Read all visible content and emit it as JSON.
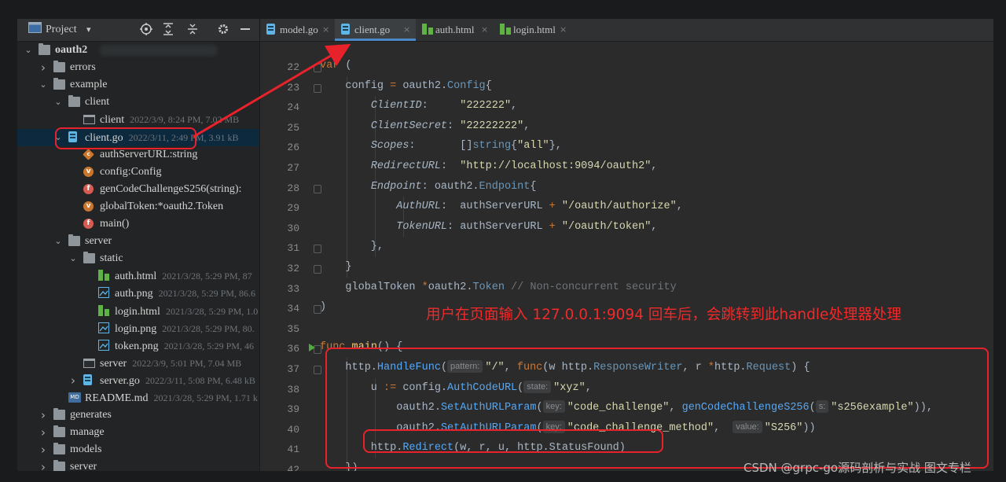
{
  "panel": {
    "title": "Project",
    "title_dropdown": "▾",
    "toolbar_icons": [
      "target-icon",
      "expand-all-icon",
      "collapse-all-icon",
      "gear-icon",
      "minimize-icon"
    ]
  },
  "tree": [
    {
      "label": "oauth2",
      "type": "folder",
      "arrow": "expanded",
      "bold": true,
      "blurred_path": true
    },
    {
      "label": "errors",
      "type": "folder",
      "arrow": "collapsed"
    },
    {
      "label": "example",
      "type": "folder",
      "arrow": "expanded"
    },
    {
      "label": "client",
      "type": "folder",
      "arrow": "expanded"
    },
    {
      "label": "client",
      "type": "binary",
      "meta": "2022/3/9, 8:24 PM, 7.02 MB"
    },
    {
      "label": "client.go",
      "type": "go",
      "arrow": "expanded",
      "meta": "2022/3/11, 2:49 PM, 3.91 kB",
      "selected": true
    },
    {
      "label": "authServerURL:string",
      "type": "member",
      "badge": "c"
    },
    {
      "label": "config:Config",
      "type": "member",
      "badge": "v"
    },
    {
      "label": "genCodeChallengeS256(string):",
      "type": "member",
      "badge": "f"
    },
    {
      "label": "globalToken:*oauth2.Token",
      "type": "member",
      "badge": "v"
    },
    {
      "label": "main()",
      "type": "member",
      "badge": "f"
    },
    {
      "label": "server",
      "type": "folder",
      "arrow": "expanded"
    },
    {
      "label": "static",
      "type": "folder",
      "arrow": "expanded"
    },
    {
      "label": "auth.html",
      "type": "html",
      "meta": "2021/3/28, 5:29 PM, 87"
    },
    {
      "label": "auth.png",
      "type": "png",
      "meta": "2021/3/28, 5:29 PM, 86.6"
    },
    {
      "label": "login.html",
      "type": "html",
      "meta": "2021/3/28, 5:29 PM, 1.0"
    },
    {
      "label": "login.png",
      "type": "png",
      "meta": "2021/3/28, 5:29 PM, 80."
    },
    {
      "label": "token.png",
      "type": "png",
      "meta": "2021/3/28, 5:29 PM, 46"
    },
    {
      "label": "server",
      "type": "binary",
      "meta": "2022/3/9, 5:01 PM, 7.04 MB"
    },
    {
      "label": "server.go",
      "type": "go",
      "arrow": "collapsed",
      "meta": "2022/3/11, 5:08 PM, 6.48 kB"
    },
    {
      "label": "README.md",
      "type": "md",
      "meta": "2021/3/28, 5:29 PM, 1.71 k"
    },
    {
      "label": "generates",
      "type": "folder",
      "arrow": "collapsed"
    },
    {
      "label": "manage",
      "type": "folder",
      "arrow": "collapsed"
    },
    {
      "label": "models",
      "type": "folder",
      "arrow": "collapsed"
    },
    {
      "label": "server",
      "type": "folder",
      "arrow": "collapsed"
    }
  ],
  "tabs": [
    {
      "label": "model.go",
      "type": "go",
      "active": false,
      "close": "×"
    },
    {
      "label": "client.go",
      "type": "go",
      "active": true,
      "close": "×"
    },
    {
      "label": "auth.html",
      "type": "html",
      "active": false,
      "close": "×"
    },
    {
      "label": "login.html",
      "type": "html",
      "active": false,
      "close": "×"
    }
  ],
  "code": {
    "line_numbers": [
      "22",
      "23",
      "24",
      "25",
      "26",
      "27",
      "28",
      "29",
      "30",
      "31",
      "32",
      "33",
      "34",
      "35",
      "36",
      "37",
      "38",
      "39",
      "40",
      "41",
      "42"
    ],
    "lines": [
      [
        {
          "t": "var",
          "c": "kw"
        },
        {
          "t": " (",
          "c": ""
        }
      ],
      [
        {
          "t": "    config ",
          "c": ""
        },
        {
          "t": "=",
          "c": "op"
        },
        {
          "t": " oauth2.",
          "c": ""
        },
        {
          "t": "Config",
          "c": "ty"
        },
        {
          "t": "{",
          "c": ""
        }
      ],
      [
        {
          "t": "        ",
          "c": ""
        },
        {
          "t": "ClientID",
          "c": "fld2"
        },
        {
          "t": ":     ",
          "c": ""
        },
        {
          "t": "\"222222\"",
          "c": "st2"
        },
        {
          "t": ",",
          "c": ""
        }
      ],
      [
        {
          "t": "        ",
          "c": ""
        },
        {
          "t": "ClientSecret",
          "c": "fld2"
        },
        {
          "t": ": ",
          "c": ""
        },
        {
          "t": "\"22222222\"",
          "c": "st2"
        },
        {
          "t": ",",
          "c": ""
        }
      ],
      [
        {
          "t": "        ",
          "c": ""
        },
        {
          "t": "Scopes",
          "c": "fld2"
        },
        {
          "t": ":       []",
          "c": ""
        },
        {
          "t": "string",
          "c": "ty"
        },
        {
          "t": "{",
          "c": ""
        },
        {
          "t": "\"all\"",
          "c": "st2"
        },
        {
          "t": "},",
          "c": ""
        }
      ],
      [
        {
          "t": "        ",
          "c": ""
        },
        {
          "t": "RedirectURL",
          "c": "fld2"
        },
        {
          "t": ":  ",
          "c": ""
        },
        {
          "t": "\"http://localhost:9094/oauth2\"",
          "c": "st2"
        },
        {
          "t": ",",
          "c": ""
        }
      ],
      [
        {
          "t": "        ",
          "c": ""
        },
        {
          "t": "Endpoint",
          "c": "fld2"
        },
        {
          "t": ": oauth2.",
          "c": ""
        },
        {
          "t": "Endpoint",
          "c": "ty"
        },
        {
          "t": "{",
          "c": ""
        }
      ],
      [
        {
          "t": "            ",
          "c": ""
        },
        {
          "t": "AuthURL",
          "c": "fld2"
        },
        {
          "t": ":  authServerURL ",
          "c": ""
        },
        {
          "t": "+",
          "c": "op"
        },
        {
          "t": " ",
          "c": ""
        },
        {
          "t": "\"/oauth/authorize\"",
          "c": "st2"
        },
        {
          "t": ",",
          "c": ""
        }
      ],
      [
        {
          "t": "            ",
          "c": ""
        },
        {
          "t": "TokenURL",
          "c": "fld2"
        },
        {
          "t": ": authServerURL ",
          "c": ""
        },
        {
          "t": "+",
          "c": "op"
        },
        {
          "t": " ",
          "c": ""
        },
        {
          "t": "\"/oauth/token\"",
          "c": "st2"
        },
        {
          "t": ",",
          "c": ""
        }
      ],
      [
        {
          "t": "        },",
          "c": ""
        }
      ],
      [
        {
          "t": "    }",
          "c": ""
        }
      ],
      [
        {
          "t": "    globalToken ",
          "c": ""
        },
        {
          "t": "*",
          "c": "op"
        },
        {
          "t": "oauth2.",
          "c": ""
        },
        {
          "t": "Token",
          "c": "ty"
        },
        {
          "t": " ",
          "c": ""
        },
        {
          "t": "// Non-concurrent security",
          "c": "cm"
        }
      ],
      [
        {
          "t": ")",
          "c": ""
        }
      ],
      [
        {
          "t": "",
          "c": ""
        }
      ],
      [
        {
          "t": "func",
          "c": "kw"
        },
        {
          "t": " ",
          "c": ""
        },
        {
          "t": "main",
          "c": "fn"
        },
        {
          "t": "() {",
          "c": ""
        }
      ],
      [
        {
          "t": "    http.",
          "c": ""
        },
        {
          "t": "HandleFunc",
          "c": "mth"
        },
        {
          "t": "(",
          "c": ""
        },
        {
          "h": "pattern:"
        },
        {
          "t": "\"/\"",
          "c": "st2"
        },
        {
          "t": ", ",
          "c": ""
        },
        {
          "t": "func",
          "c": "kw"
        },
        {
          "t": "(w http.",
          "c": ""
        },
        {
          "t": "ResponseWriter",
          "c": "ty"
        },
        {
          "t": ", r ",
          "c": ""
        },
        {
          "t": "*",
          "c": "op"
        },
        {
          "t": "http.",
          "c": ""
        },
        {
          "t": "Request",
          "c": "ty"
        },
        {
          "t": ") {",
          "c": ""
        }
      ],
      [
        {
          "t": "        u ",
          "c": ""
        },
        {
          "t": ":=",
          "c": "op"
        },
        {
          "t": " config.",
          "c": ""
        },
        {
          "t": "AuthCodeURL",
          "c": "mth"
        },
        {
          "t": "(",
          "c": ""
        },
        {
          "h": "state:"
        },
        {
          "t": "\"xyz\"",
          "c": "st2"
        },
        {
          "t": ",",
          "c": ""
        }
      ],
      [
        {
          "t": "            oauth2.",
          "c": ""
        },
        {
          "t": "SetAuthURLParam",
          "c": "mth"
        },
        {
          "t": "(",
          "c": ""
        },
        {
          "h": "key:"
        },
        {
          "t": "\"code_challenge\"",
          "c": "st2"
        },
        {
          "t": ", ",
          "c": ""
        },
        {
          "t": "genCodeChallengeS256",
          "c": "mth"
        },
        {
          "t": "(",
          "c": ""
        },
        {
          "h": "s:"
        },
        {
          "t": "\"s256example\"",
          "c": "st2"
        },
        {
          "t": ")),",
          "c": ""
        }
      ],
      [
        {
          "t": "            oauth2.",
          "c": ""
        },
        {
          "t": "SetAuthURLParam",
          "c": "mth"
        },
        {
          "t": "(",
          "c": ""
        },
        {
          "h": "key:"
        },
        {
          "t": "\"code_challenge_method\"",
          "c": "st2"
        },
        {
          "t": ",  ",
          "c": ""
        },
        {
          "h": "value:"
        },
        {
          "t": "\"S256\"",
          "c": "st2"
        },
        {
          "t": "))",
          "c": ""
        }
      ],
      [
        {
          "t": "        http.",
          "c": ""
        },
        {
          "t": "Redirect",
          "c": "mth"
        },
        {
          "t": "(w, r, u, http.StatusFound)",
          "c": ""
        }
      ],
      [
        {
          "t": "    })",
          "c": ""
        }
      ]
    ]
  },
  "annotation": {
    "text": "用户在页面输入 127.0.0.1:9094 回车后，会跳转到此handle处理器处理",
    "color": "#f02a2a"
  },
  "watermark": "CSDN @grpc-go源码剖析与实战 图文专栏",
  "colors": {
    "accent": "#4a88c7",
    "annotation_red": "#e8222b",
    "selected_row": "#0d293e"
  }
}
